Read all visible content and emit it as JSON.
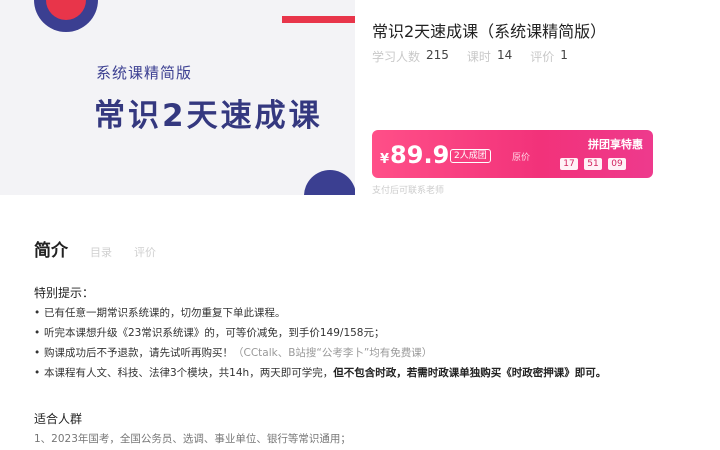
{
  "banner": {
    "subtitle": "系统课精简版",
    "title": "常识2天速成课"
  },
  "course": {
    "title": "常识2天速成课（系统课精简版）",
    "stats": [
      {
        "label": "学习人数",
        "value": "215"
      },
      {
        "label": "课时",
        "value": "14"
      },
      {
        "label": "评价",
        "value": "1"
      }
    ]
  },
  "price_box": {
    "currency": "¥",
    "price": "89.9",
    "group_tag": "2人成团",
    "orig_label": "原价",
    "promo_label": "拼团享特惠",
    "timer": [
      "17",
      "51",
      "09"
    ]
  },
  "price_note": "支付后可联系老师",
  "tabs": {
    "active": "简介",
    "items": [
      "目录",
      "评价"
    ]
  },
  "notice": {
    "heading": "特别提示：",
    "items": [
      {
        "bullet": "•",
        "text": "已有任意一期常识系统课的，切勿重复下单此课程。"
      },
      {
        "bullet": "•",
        "text": "听完本课想升级《23常识系统课》的，可等价减免，到手价149/158元；"
      },
      {
        "bullet": "•",
        "text": "购课成功后不予退款，请先试听再购买！",
        "extra": "（CCtalk、B站搜“公考李卜”均有免费课）"
      },
      {
        "bullet": "•",
        "text": "本课程有人文、科技、法律3个模块，共14h，两天即可学完，",
        "bold": "但不包含时政，若需时政课单独购买《时政密押课》即可。"
      }
    ]
  },
  "audience": {
    "heading": "适合人群",
    "items": [
      "1、2023年国考，全国公务员、选调、事业单位、银行等常识通用；"
    ]
  }
}
